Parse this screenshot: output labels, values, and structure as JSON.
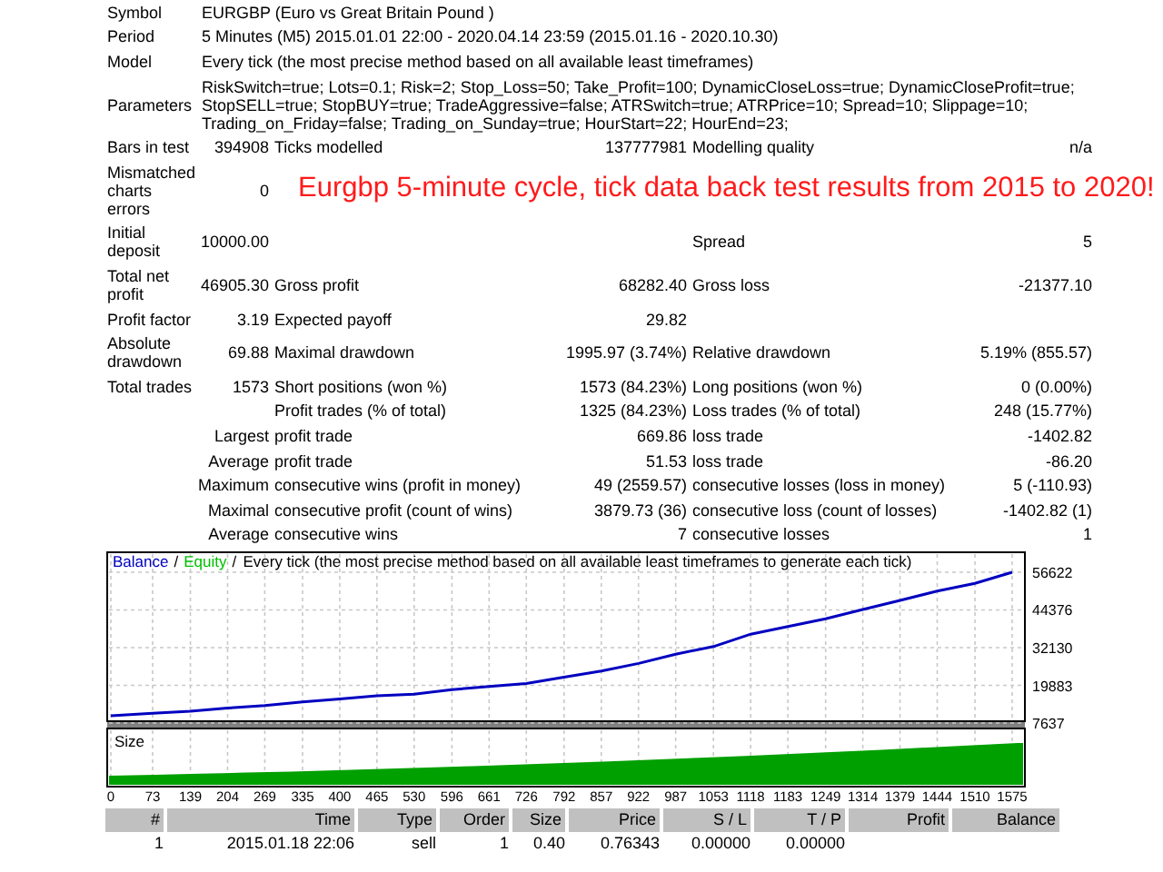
{
  "report_rows": [
    {
      "kind": "wide",
      "label": "Symbol",
      "value": "EURGBP (Euro vs Great Britain Pound )"
    },
    {
      "kind": "wide",
      "label": "Period",
      "value": "5 Minutes (M5) 2015.01.01 22:00 - 2020.04.14 23:59 (2015.01.16 - 2020.10.30)"
    },
    {
      "kind": "wide",
      "label": "Model",
      "value": "Every tick (the most precise method based on all available least timeframes)"
    },
    {
      "kind": "wide",
      "label": "Parameters",
      "value": "RiskSwitch=true; Lots=0.1; Risk=2; Stop_Loss=50; Take_Profit=100; DynamicCloseLoss=true; DynamicCloseProfit=true; StopSELL=true; StopBUY=true; TradeAggressive=false; ATRSwitch=true; ATRPrice=10; Spread=10; Slippage=10; Trading_on_Friday=false; Trading_on_Sunday=true; HourStart=22; HourEnd=23;"
    },
    {
      "kind": "stats",
      "label": "Bars in test",
      "value": "394908",
      "label_2": "Ticks modelled",
      "value_2": "137777981",
      "label_3": "Modelling quality",
      "value_3": "n/a"
    },
    {
      "kind": "stats",
      "label": "Mismatched charts errors",
      "value": "0",
      "note": "Eurgbp 5-minute cycle, tick data back test results from 2015 to 2020!"
    },
    {
      "kind": "stats",
      "label": "Initial deposit",
      "value": "10000.00",
      "label_3": "Spread",
      "value_3": "5"
    },
    {
      "kind": "stats",
      "label": "Total net profit",
      "value": "46905.30",
      "label_2": "Gross profit",
      "value_2": "68282.40",
      "label_3": "Gross loss",
      "value_3": "-21377.10"
    },
    {
      "kind": "stats",
      "label": "Profit factor",
      "value": "3.19",
      "label_2": "Expected payoff",
      "value_2": "29.82"
    },
    {
      "kind": "stats",
      "label": "Absolute drawdown",
      "value": "69.88",
      "label_2": "Maximal drawdown",
      "value_2": "1995.97 (3.74%)",
      "label_3": "Relative drawdown",
      "value_3": "5.19% (855.57)"
    },
    {
      "kind": "stats",
      "label": "Total trades",
      "value": "1573",
      "label_2": "Short positions (won %)",
      "value_2": "1573 (84.23%)",
      "label_3": "Long positions (won %)",
      "value_3": "0 (0.00%)"
    },
    {
      "kind": "stats",
      "label_2": "Profit trades (% of total)",
      "value_2": "1325 (84.23%)",
      "label_3": "Loss trades (% of total)",
      "value_3": "248 (15.77%)"
    },
    {
      "kind": "stats",
      "value": "Largest",
      "label_2": "profit trade",
      "value_2": "669.86",
      "label_3": "loss trade",
      "value_3": "-1402.82"
    },
    {
      "kind": "stats",
      "value": "Average",
      "label_2": "profit trade",
      "value_2": "51.53",
      "label_3": "loss trade",
      "value_3": "-86.20"
    },
    {
      "kind": "stats",
      "value": "Maximum",
      "label_2": "consecutive wins (profit in money)",
      "value_2": "49 (2559.57)",
      "label_3": "consecutive losses (loss in money)",
      "value_3": "5 (-110.93)"
    },
    {
      "kind": "stats",
      "value": "Maximal",
      "label_2": "consecutive profit (count of wins)",
      "value_2": "3879.73 (36)",
      "label_3": "consecutive loss (count of losses)",
      "value_3": "-1402.82 (1)"
    },
    {
      "kind": "stats",
      "value": "Average",
      "label_2": "consecutive wins",
      "value_2": "7",
      "label_3": "consecutive losses",
      "value_3": "1"
    }
  ],
  "chart": {
    "chart_data": {
      "type": "line",
      "title": "Every tick (the most precise method based on all available least timeframes to generate each tick)",
      "x": [
        0,
        73,
        139,
        204,
        269,
        335,
        400,
        465,
        530,
        596,
        661,
        726,
        792,
        857,
        922,
        987,
        1053,
        1118,
        1183,
        1249,
        1314,
        1379,
        1444,
        1510,
        1575
      ],
      "series": [
        {
          "name": "Balance",
          "color": "#0000c0",
          "values": [
            10000,
            10800,
            11500,
            12500,
            13300,
            14500,
            15500,
            16500,
            17000,
            18500,
            19500,
            20500,
            22500,
            24500,
            27000,
            30000,
            32500,
            36500,
            39000,
            41500,
            44500,
            47500,
            50500,
            53000,
            56600
          ]
        }
      ],
      "xlim": [
        0,
        1575
      ],
      "ylim": [
        7637,
        56622
      ],
      "xticks": [
        0,
        73,
        139,
        204,
        269,
        335,
        400,
        465,
        530,
        596,
        661,
        726,
        792,
        857,
        922,
        987,
        1053,
        1118,
        1183,
        1249,
        1314,
        1379,
        1444,
        1510,
        1575
      ],
      "yticks": [
        7637,
        19883,
        32130,
        44376,
        56622
      ],
      "grid": true
    },
    "legend_separators": [
      "/",
      "/"
    ],
    "equity_legend": {
      "label": "Equity",
      "color": "#00c000"
    },
    "size_panel": {
      "label": "Size"
    }
  },
  "trades": {
    "columns": [
      "#",
      "Time",
      "Type",
      "Order",
      "Size",
      "Price",
      "S / L",
      "T / P",
      "Profit",
      "Balance"
    ],
    "rows": [
      [
        "1",
        "2015.01.18 22:06",
        "sell",
        "1",
        "0.40",
        "0.76343",
        "0.00000",
        "0.00000"
      ]
    ]
  }
}
